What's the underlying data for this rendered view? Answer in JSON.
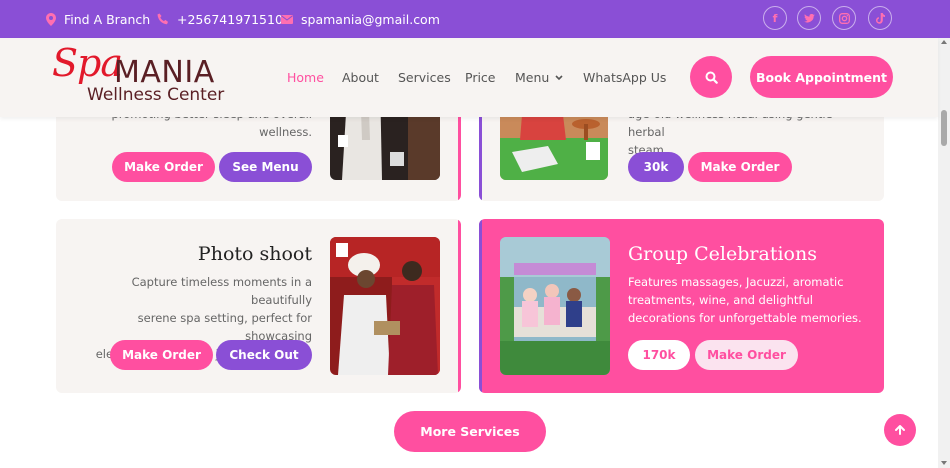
{
  "topbar": {
    "branch": "Find A Branch",
    "phone": "+256741971510",
    "email": "spamania@gmail.com",
    "social": [
      {
        "icon": "facebook-icon",
        "glyph": "f"
      },
      {
        "icon": "twitter-icon",
        "glyph": "t"
      },
      {
        "icon": "instagram-icon",
        "glyph": "◎"
      },
      {
        "icon": "tiktok-icon",
        "glyph": "♪"
      }
    ]
  },
  "brand": {
    "spa": "Spa",
    "mania": "MANIA",
    "subtitle": "Wellness Center"
  },
  "nav": {
    "home": "Home",
    "about": "About",
    "services": "Services",
    "price": "Price",
    "menu": "Menu",
    "whatsapp": "WhatsApp Us",
    "book": "Book Appointment"
  },
  "cards": {
    "top_left": {
      "desc_line1": "promoting better sleep and overall",
      "desc_line2": "wellness.",
      "btn1": "Make Order",
      "btn2": "See Menu"
    },
    "top_right": {
      "desc_line1": "age-old wellness ritual using gentle herbal",
      "desc_line2": "steam.",
      "price": "30k",
      "btn": "Make Order"
    },
    "photo_shoot": {
      "title": "Photo shoot",
      "desc_line1": "Capture timeless moments in a beautifully",
      "desc_line2": "serene spa setting, perfect for showcasing",
      "desc_line3": "elegance, style, and joyful memories.",
      "btn1": "Make Order",
      "btn2": "Check Out"
    },
    "group": {
      "title": "Group Celebrations",
      "desc_line1": "Features massages, Jacuzzi, aromatic",
      "desc_line2": "treatments, wine, and delightful",
      "desc_line3": "decorations for unforgettable memories.",
      "price": "170k",
      "btn": "Make Order"
    }
  },
  "more_services": "More Services",
  "colors": {
    "purple": "#8a4fd6",
    "pink": "#ff4fa0",
    "brand_red": "#e2192b",
    "brand_brown": "#5a1f24"
  }
}
